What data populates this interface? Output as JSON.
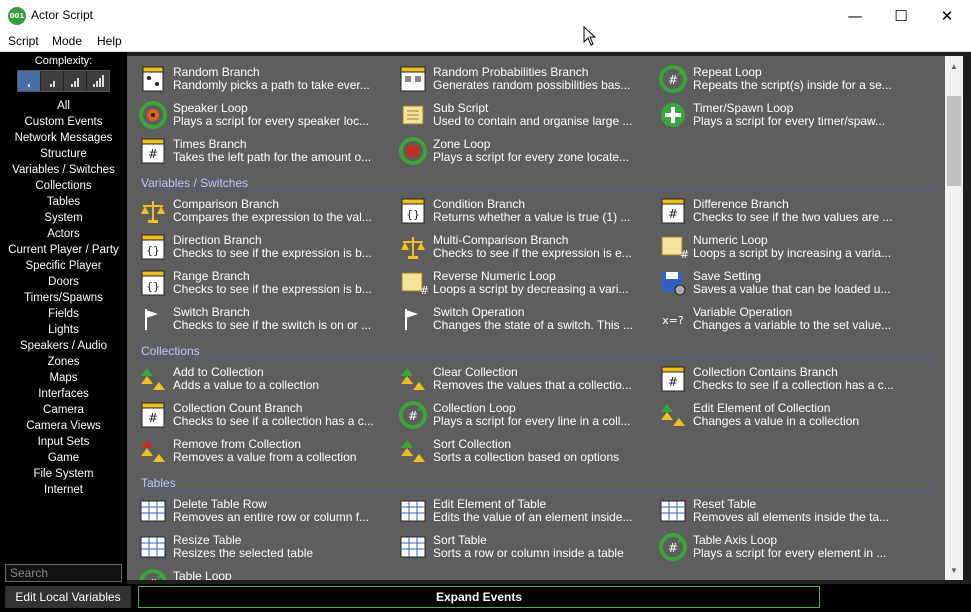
{
  "window": {
    "title": "Actor Script",
    "icon_label": "001",
    "minimize": "—",
    "maximize": "☐",
    "close": "✕"
  },
  "menu": [
    "Script",
    "Mode",
    "Help"
  ],
  "sidebar": {
    "complexity_label": "Complexity:",
    "nav": [
      "All",
      "Custom Events",
      "Network Messages",
      "Structure",
      "Variables / Switches",
      "Collections",
      "Tables",
      "System",
      "Actors",
      "Current Player / Party",
      "Specific Player",
      "Doors",
      "Timers/Spawns",
      "Fields",
      "Lights",
      "Speakers / Audio",
      "Zones",
      "Maps",
      "Interfaces",
      "Camera",
      "Camera Views",
      "Input Sets",
      "Game",
      "File System",
      "Internet"
    ],
    "search_placeholder": "Search"
  },
  "sections": [
    {
      "title": "",
      "items": [
        {
          "name": "Random Branch",
          "desc": "Randomly picks a path to take ever...",
          "icon": "dice-icon"
        },
        {
          "name": "Random Probabilities Branch",
          "desc": "Generates random possibilities bas...",
          "icon": "dice-probabilities-icon"
        },
        {
          "name": "Repeat Loop",
          "desc": "Repeats the script(s) inside for a se...",
          "icon": "repeat-loop-icon"
        },
        {
          "name": "Speaker Loop",
          "desc": "Plays a script for every speaker loc...",
          "icon": "speaker-loop-icon"
        },
        {
          "name": "Sub Script",
          "desc": "Used to contain and organise large ...",
          "icon": "scroll-icon"
        },
        {
          "name": "Timer/Spawn Loop",
          "desc": "Plays a script for every timer/spaw...",
          "icon": "timer-spawn-loop-icon"
        },
        {
          "name": "Times Branch",
          "desc": "Takes the left path for the amount o...",
          "icon": "times-branch-icon"
        },
        {
          "name": "Zone Loop",
          "desc": "Plays a script for every zone locate...",
          "icon": "zone-loop-icon"
        }
      ]
    },
    {
      "title": "Variables / Switches",
      "items": [
        {
          "name": "Comparison Branch",
          "desc": "Compares the expression to the val...",
          "icon": "scales-icon"
        },
        {
          "name": "Condition Branch",
          "desc": "Returns whether a value is true (1) ...",
          "icon": "condition-branch-icon"
        },
        {
          "name": "Difference Branch",
          "desc": "Checks to see if the two values are ...",
          "icon": "difference-branch-icon"
        },
        {
          "name": "Direction Branch",
          "desc": "Checks to see if the expression is b...",
          "icon": "direction-branch-icon"
        },
        {
          "name": "Multi-Comparison Branch",
          "desc": "Checks to see if the expression is e...",
          "icon": "multi-scales-icon"
        },
        {
          "name": "Numeric Loop",
          "desc": "Loops a script by increasing a varia...",
          "icon": "numeric-loop-icon"
        },
        {
          "name": "Range Branch",
          "desc": "Checks to see if the expression is b...",
          "icon": "range-branch-icon"
        },
        {
          "name": "Reverse Numeric Loop",
          "desc": "Loops a script by decreasing a vari...",
          "icon": "reverse-numeric-loop-icon"
        },
        {
          "name": "Save Setting",
          "desc": "Saves a value that can be loaded u...",
          "icon": "save-setting-icon"
        },
        {
          "name": "Switch Branch",
          "desc": "Checks to see if the switch is on or ...",
          "icon": "switch-branch-icon"
        },
        {
          "name": "Switch Operation",
          "desc": "Changes the state of a switch. This ...",
          "icon": "switch-operation-icon"
        },
        {
          "name": "Variable Operation",
          "desc": "Changes a variable to the set value...",
          "icon": "variable-operation-icon"
        }
      ]
    },
    {
      "title": "Collections",
      "items": [
        {
          "name": "Add to Collection",
          "desc": "Adds a value to a collection",
          "icon": "add-collection-icon"
        },
        {
          "name": "Clear Collection",
          "desc": "Removes the values that a collectio...",
          "icon": "clear-collection-icon"
        },
        {
          "name": "Collection Contains Branch",
          "desc": "Checks to see if a collection has a c...",
          "icon": "collection-contains-icon"
        },
        {
          "name": "Collection Count Branch",
          "desc": "Checks to see if a collection has a c...",
          "icon": "collection-count-icon"
        },
        {
          "name": "Collection Loop",
          "desc": "Plays a script for every line in a coll...",
          "icon": "collection-loop-icon"
        },
        {
          "name": "Edit Element of Collection",
          "desc": "Changes a value in a collection",
          "icon": "edit-collection-icon"
        },
        {
          "name": "Remove from Collection",
          "desc": "Removes a value from a collection",
          "icon": "remove-collection-icon"
        },
        {
          "name": "Sort Collection",
          "desc": "Sorts a collection based on options",
          "icon": "sort-collection-icon"
        }
      ]
    },
    {
      "title": "Tables",
      "items": [
        {
          "name": "Delete Table Row",
          "desc": "Removes an entire row or column f...",
          "icon": "delete-table-row-icon"
        },
        {
          "name": "Edit Element of Table",
          "desc": "Edits the value of an element inside...",
          "icon": "edit-table-icon"
        },
        {
          "name": "Reset Table",
          "desc": "Removes all elements inside the ta...",
          "icon": "reset-table-icon"
        },
        {
          "name": "Resize Table",
          "desc": "Resizes the selected table",
          "icon": "resize-table-icon"
        },
        {
          "name": "Sort Table",
          "desc": "Sorts a row or column inside a table",
          "icon": "sort-table-icon"
        },
        {
          "name": "Table Axis Loop",
          "desc": "Plays a script for every element in ...",
          "icon": "table-axis-loop-icon"
        },
        {
          "name": "Table Loop",
          "desc": "",
          "icon": "table-loop-icon"
        }
      ]
    }
  ],
  "bottom": {
    "local_vars": "Edit Local Variables",
    "expand": "Expand Events"
  },
  "colors": {
    "panel": "#5e5e5e",
    "section_title": "#b8c8ff",
    "accent_green": "#4bb34b"
  }
}
